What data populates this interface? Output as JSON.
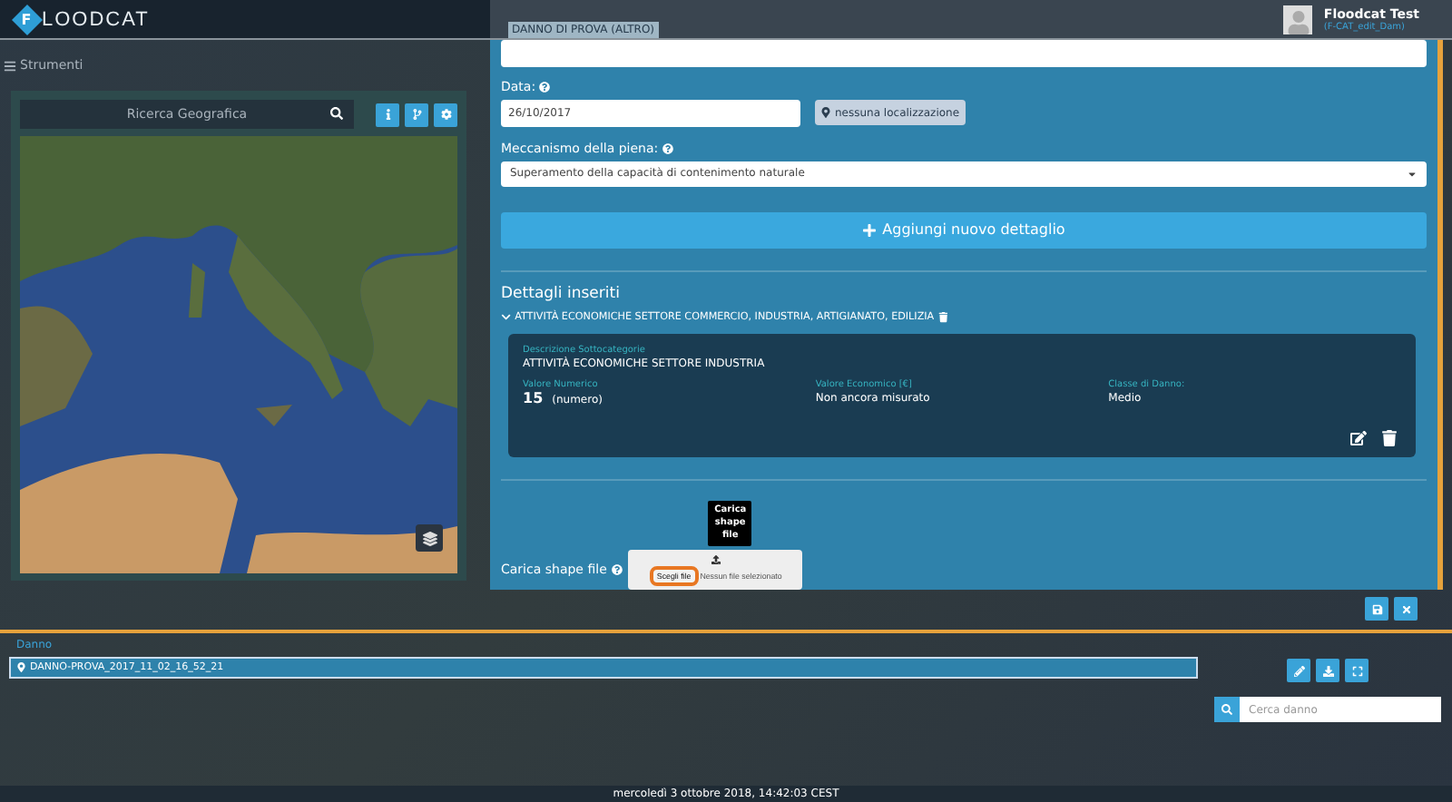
{
  "header": {
    "logo_initial": "F",
    "logo_rest": "LOODCAT",
    "form_title": "DANNO DI PROVA (ALTRO)",
    "user": {
      "name": "Floodcat Test",
      "role": "(F-CAT_edit_Dam)"
    }
  },
  "tools": {
    "label": "Strumenti",
    "search": {
      "placeholder": "Ricerca Geografica"
    }
  },
  "form": {
    "date": {
      "label": "Data:",
      "value": "26/10/2017",
      "location_button": "nessuna localizzazione"
    },
    "mechanism": {
      "label": "Meccanismo della piena:",
      "value": "Superamento della capacità di contenimento naturale"
    },
    "add_button": "Aggiungi nuovo dettaglio",
    "details_title": "Dettagli inseriti",
    "group": {
      "title": "ATTIVITÀ ECONOMICHE SETTORE COMMERCIO, INDUSTRIA, ARTIGIANATO, EDILIZIA",
      "expanded": true,
      "card": {
        "subcategory_label": "Descrizione Sottocategorie",
        "subcategory": "ATTIVITÀ ECONOMICHE SETTORE INDUSTRIA",
        "fields": [
          {
            "label": "Valore Numerico",
            "value": "15",
            "unit": "(numero)"
          },
          {
            "label": "Valore Economico [€]",
            "value": "Non ancora misurato"
          },
          {
            "label": "Classe di Danno:",
            "value": "Medio"
          }
        ]
      }
    },
    "shape_file": {
      "label": "Carica shape file",
      "tooltip": "Carica shape file",
      "choose_button": "Scegli file",
      "focused": true,
      "status": "Nessun file selezionato"
    }
  },
  "danno": {
    "title": "Danno",
    "items": [
      {
        "label": "DANNO-PROVA_2017_11_02_16_52_21",
        "selected": true
      }
    ],
    "search": {
      "placeholder": "Cerca danno"
    }
  },
  "status_bar": "mercoledì 3 ottobre 2018, 14:42:03 CEST"
}
